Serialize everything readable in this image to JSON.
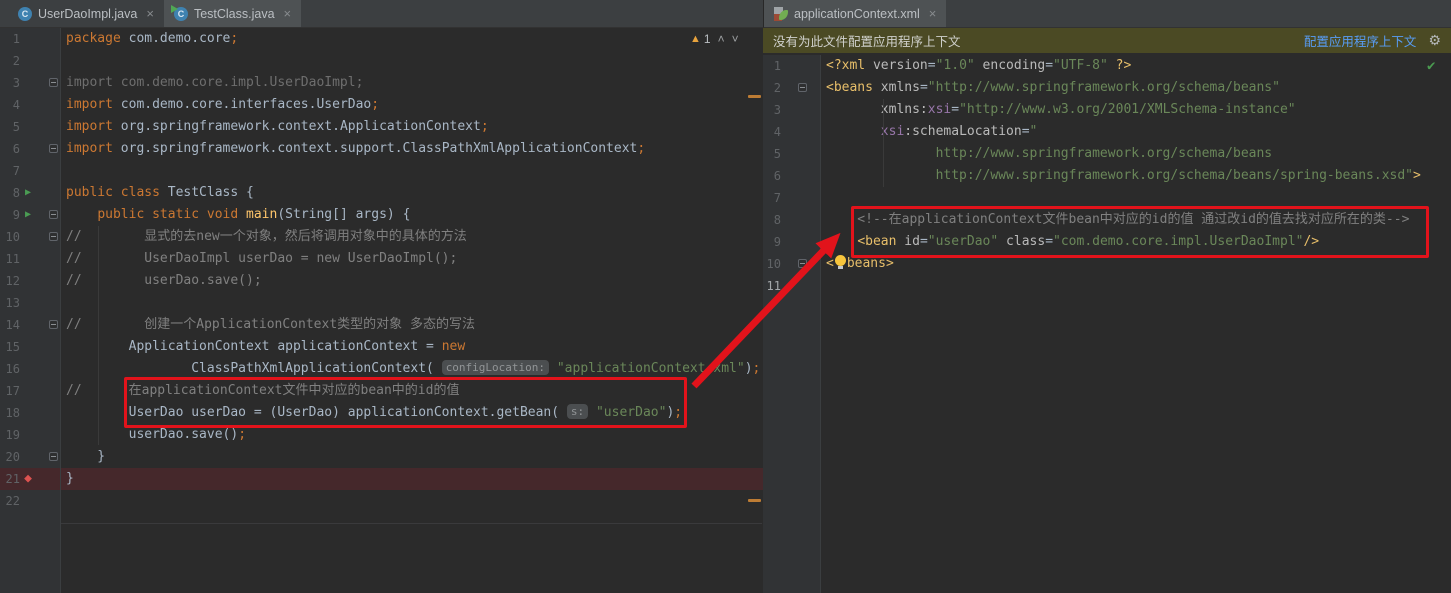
{
  "colors": {
    "editor_bg": "#2b2b2b",
    "gutter_bg": "#313335",
    "tabbar_bg": "#3c3f41",
    "active_tab_bg": "#4e5254",
    "banner_bg": "#4b4a24",
    "link_blue": "#589df6",
    "keyword_orange": "#cc7832",
    "string_green": "#6a8759",
    "comment_gray": "#808080",
    "tag_yellow": "#e8bf6a",
    "ns_purple": "#9876aa",
    "annotation_red": "#e2131b",
    "run_green": "#4a9c53",
    "breakpoint_red": "#dd5250",
    "breakpoint_line_bg": "#45282b",
    "warning_yellow": "#e8a33d",
    "check_green": "#4a9b50",
    "stripe_orange": "#bd7c34"
  },
  "icons": {
    "class_letter": "C",
    "close": "×",
    "gear": "⚙",
    "check": "✔",
    "run": "▶",
    "breakpoint": "◆",
    "warning": "▲",
    "chevron_up": "˄",
    "chevron_down": "˅"
  },
  "left_pane": {
    "tabs": [
      {
        "label": "UserDaoImpl.java",
        "icon": "java-class-icon",
        "active": false
      },
      {
        "label": "TestClass.java",
        "icon": "java-class-runnable-icon",
        "active": true
      }
    ],
    "warning_count": "1",
    "editor": {
      "lines": [
        {
          "n": 1,
          "segs": [
            [
              "kw",
              "package "
            ],
            [
              "def",
              "com.demo.core"
            ],
            [
              "kw",
              ";"
            ]
          ]
        },
        {
          "n": 2,
          "segs": []
        },
        {
          "n": 3,
          "g": "fold",
          "segs": [
            [
              "un",
              "import com.demo.core.impl.UserDaoImpl;"
            ]
          ]
        },
        {
          "n": 4,
          "segs": [
            [
              "kw",
              "import "
            ],
            [
              "def",
              "com.demo.core.interfaces.UserDao"
            ],
            [
              "kw",
              ";"
            ]
          ]
        },
        {
          "n": 5,
          "segs": [
            [
              "kw",
              "import "
            ],
            [
              "def",
              "org.springframework.context.ApplicationContext"
            ],
            [
              "kw",
              ";"
            ]
          ]
        },
        {
          "n": 6,
          "g": "fold",
          "segs": [
            [
              "kw",
              "import "
            ],
            [
              "def",
              "org.springframework.context.support.ClassPathXmlApplicationContext"
            ],
            [
              "kw",
              ";"
            ]
          ]
        },
        {
          "n": 7,
          "segs": []
        },
        {
          "n": 8,
          "g": "run",
          "segs": [
            [
              "kw",
              "public class "
            ],
            [
              "def",
              "TestClass {"
            ]
          ]
        },
        {
          "n": 9,
          "g": "run fold",
          "segs": [
            [
              "def",
              "    "
            ],
            [
              "kw",
              "public static void "
            ],
            [
              "md",
              "main"
            ],
            [
              "def",
              "(String[] args) {"
            ]
          ]
        },
        {
          "n": 10,
          "g": "fold",
          "segs": [
            [
              "com",
              "//        显式的去new一个对象，然后将调用对象中的具体的方法"
            ]
          ]
        },
        {
          "n": 11,
          "segs": [
            [
              "com",
              "//        UserDaoImpl userDao = new UserDaoImpl();"
            ]
          ]
        },
        {
          "n": 12,
          "segs": [
            [
              "com",
              "//        userDao.save();"
            ]
          ]
        },
        {
          "n": 13,
          "segs": []
        },
        {
          "n": 14,
          "g": "fold",
          "segs": [
            [
              "com",
              "//        创建一个ApplicationContext类型的对象 多态的写法"
            ]
          ]
        },
        {
          "n": 15,
          "segs": [
            [
              "def",
              "        ApplicationContext applicationContext = "
            ],
            [
              "kw",
              "new"
            ]
          ]
        },
        {
          "n": 16,
          "segs": [
            [
              "def",
              "                ClassPathXmlApplicationContext( "
            ],
            [
              "hint",
              "configLocation:"
            ],
            [
              "def",
              " "
            ],
            [
              "str",
              "\"applicationContext.xml\""
            ],
            [
              "def",
              ")"
            ],
            [
              "kw",
              ";"
            ]
          ]
        },
        {
          "n": 17,
          "segs": [
            [
              "com",
              "//      在applicationContext文件中对应的bean中的id的值"
            ]
          ]
        },
        {
          "n": 18,
          "segs": [
            [
              "def",
              "        UserDao userDao = (UserDao) applicationContext.getBean( "
            ],
            [
              "hint",
              "s:"
            ],
            [
              "def",
              " "
            ],
            [
              "str",
              "\"userDao\""
            ],
            [
              "def",
              ")"
            ],
            [
              "kw",
              ";"
            ]
          ]
        },
        {
          "n": 19,
          "segs": [
            [
              "def",
              "        userDao.save()"
            ],
            [
              "kw",
              ";"
            ]
          ]
        },
        {
          "n": 20,
          "g": "fold",
          "segs": [
            [
              "def",
              "    }"
            ]
          ]
        },
        {
          "n": 21,
          "g": "bp",
          "bp": true,
          "segs": [
            [
              "def",
              "}"
            ]
          ]
        },
        {
          "n": 22,
          "segs": []
        }
      ]
    }
  },
  "right_pane": {
    "tabs": [
      {
        "label": "applicationContext.xml",
        "icon": "spring-xml-icon",
        "active": true
      }
    ],
    "banner": {
      "message": "没有为此文件配置应用程序上下文",
      "action": "配置应用程序上下文"
    },
    "editor": {
      "lines": [
        {
          "n": 1,
          "segs": [
            [
              "tag",
              "<?xml "
            ],
            [
              "attr",
              "version"
            ],
            [
              "def",
              "="
            ],
            [
              "str",
              "\"1.0\""
            ],
            [
              "attr",
              " encoding"
            ],
            [
              "def",
              "="
            ],
            [
              "str",
              "\"UTF-8\""
            ],
            [
              "tag",
              " ?>"
            ]
          ]
        },
        {
          "n": 2,
          "g": "fold",
          "segs": [
            [
              "tag",
              "<beans"
            ],
            [
              "def",
              " "
            ],
            [
              "attr",
              "xmlns"
            ],
            [
              "def",
              "="
            ],
            [
              "str",
              "\"http://www.springframework.org/schema/beans\""
            ]
          ]
        },
        {
          "n": 3,
          "segs": [
            [
              "def",
              "       "
            ],
            [
              "attr",
              "xmlns:"
            ],
            [
              "ns",
              "xsi"
            ],
            [
              "def",
              "="
            ],
            [
              "str",
              "\"http://www.w3.org/2001/XMLSchema-instance\""
            ]
          ]
        },
        {
          "n": 4,
          "segs": [
            [
              "def",
              "       "
            ],
            [
              "ns",
              "xsi"
            ],
            [
              "attr",
              ":schemaLocation"
            ],
            [
              "def",
              "="
            ],
            [
              "str",
              "\""
            ]
          ]
        },
        {
          "n": 5,
          "segs": [
            [
              "str",
              "              http://www.springframework.org/schema/beans"
            ]
          ]
        },
        {
          "n": 6,
          "segs": [
            [
              "str",
              "              http://www.springframework.org/schema/beans/spring-beans.xsd\""
            ],
            [
              "tag",
              ">"
            ]
          ]
        },
        {
          "n": 7,
          "segs": []
        },
        {
          "n": 8,
          "segs": [
            [
              "com",
              "    <!--在applicationContext文件bean中对应的id的值 通过改id的值去找对应所在的类-->"
            ]
          ]
        },
        {
          "n": 9,
          "segs": [
            [
              "def",
              "    "
            ],
            [
              "tag",
              "<bean"
            ],
            [
              "def",
              " "
            ],
            [
              "attr",
              "id"
            ],
            [
              "def",
              "="
            ],
            [
              "str",
              "\"userDao\""
            ],
            [
              "def",
              " "
            ],
            [
              "attr",
              "class"
            ],
            [
              "def",
              "="
            ],
            [
              "str",
              "\"com.demo.core.impl.UserDaoImpl\""
            ],
            [
              "tag",
              "/>"
            ]
          ]
        },
        {
          "n": 10,
          "g": "fold",
          "segs": [
            [
              "tag",
              "<"
            ],
            [
              "bulb",
              ""
            ],
            [
              "tag",
              "beans>"
            ]
          ]
        },
        {
          "n": 11,
          "hl": true,
          "segs": []
        }
      ]
    }
  }
}
